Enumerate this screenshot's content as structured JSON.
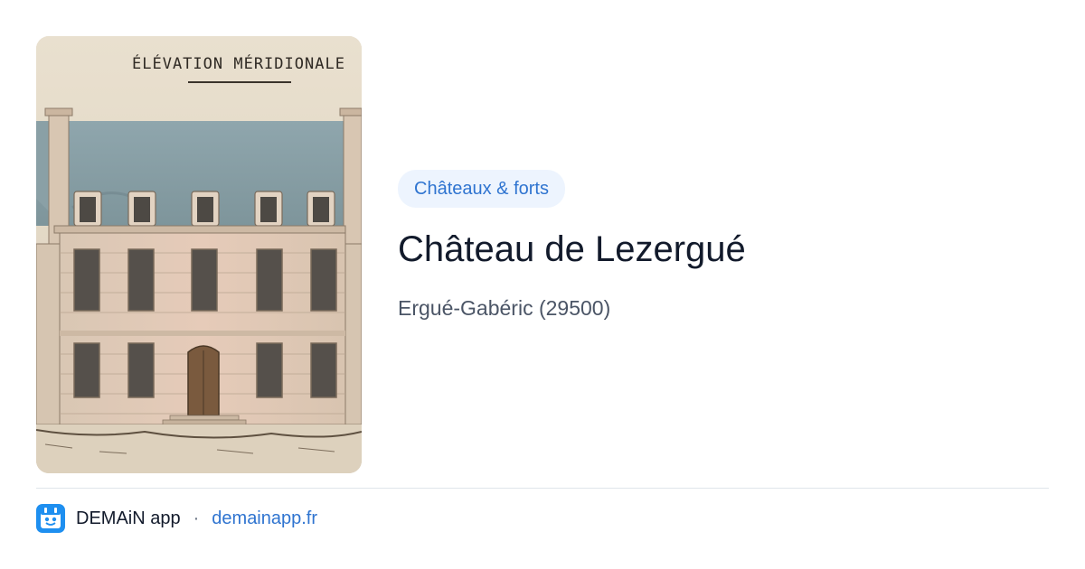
{
  "image": {
    "caption": "ÉLÉVATION MÉRIDIONALE"
  },
  "category": {
    "label": "Châteaux & forts"
  },
  "place": {
    "name": "Château de Lezergué",
    "location": "Ergué-Gabéric (29500)"
  },
  "footer": {
    "app_name": "DEMAiN app",
    "separator": "·",
    "site": "demainapp.fr",
    "icon": "demain-app-logo-icon"
  },
  "colors": {
    "accent": "#2f74d0",
    "chip_bg": "#edf4fe",
    "title": "#121a2b",
    "subtitle": "#4b5566"
  }
}
